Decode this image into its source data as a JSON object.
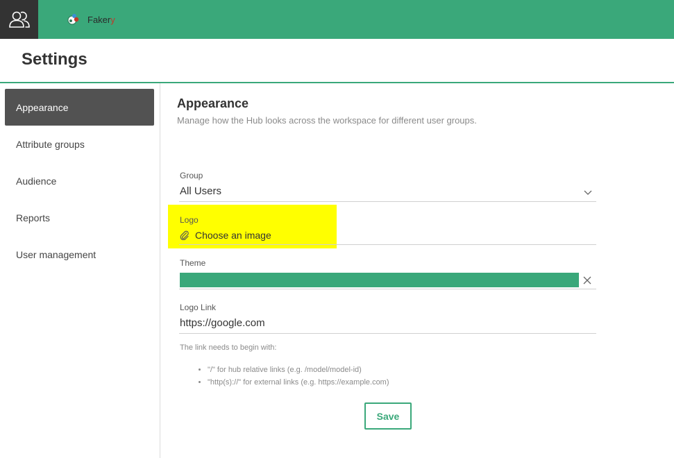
{
  "topbar": {
    "user_icon": "users-icon",
    "brand": {
      "name": "Faker",
      "name_accent": "y",
      "logo_icon": "fakery-logo-icon"
    }
  },
  "page": {
    "title": "Settings"
  },
  "sidebar": {
    "items": [
      {
        "label": "Appearance",
        "active": true
      },
      {
        "label": "Attribute groups",
        "active": false
      },
      {
        "label": "Audience",
        "active": false
      },
      {
        "label": "Reports",
        "active": false
      },
      {
        "label": "User management",
        "active": false
      }
    ]
  },
  "main": {
    "title": "Appearance",
    "subtitle": "Manage how the Hub looks across the workspace for different user groups.",
    "group": {
      "label": "Group",
      "value": "All Users",
      "icon": "chevron-down-icon"
    },
    "logo": {
      "label": "Logo",
      "action": "Choose an image",
      "icon": "paperclip-icon"
    },
    "theme": {
      "label": "Theme",
      "color": "#3aa87a",
      "clear_icon": "close-icon"
    },
    "logo_link": {
      "label": "Logo Link",
      "value": "https://google.com",
      "hint": "The link needs to begin with:",
      "rules": [
        "\"/\" for hub relative links (e.g. /model/model-id)",
        "\"http(s)://\" for external links (e.g. https://example.com)"
      ]
    },
    "save_label": "Save"
  },
  "colors": {
    "brand_green": "#3aa87a",
    "sidebar_active": "#525252",
    "highlight": "#ffff00"
  }
}
